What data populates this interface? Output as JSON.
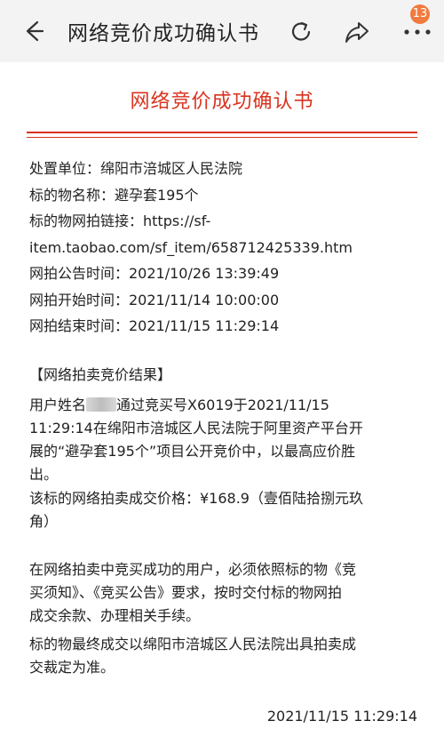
{
  "header": {
    "title": "网络竞价成功确认书",
    "badge_count": "13",
    "icons": [
      "back-arrow-icon",
      "refresh-icon",
      "share-icon",
      "more-icon"
    ]
  },
  "document": {
    "title": "网络竞价成功确认书",
    "accent_color": "#d8331f",
    "info": {
      "unit": "处置单位：绵阳市涪城区人民法院",
      "item_name": "标的物名称：避孕套195个",
      "link_line1": "标的物网拍链接：https://sf-",
      "link_line2": "item.taobao.com/sf_item/658712425339.htm",
      "announce_time": "网拍公告时间：2021/10/26 13:39:49",
      "start_time": "网拍开始时间：2021/11/14 10:00:00",
      "end_time": "网拍结束时间：2021/11/15 11:29:14"
    },
    "result_heading": "【网络拍卖竞价结果】",
    "result": {
      "l1_pre": "用户姓名",
      "l1_post": "通过竞买号X6019于2021/11/15",
      "l2": "11:29:14在绵阳市涪城区人民法院于阿里资产平台开",
      "l3": "展的“避孕套195个”项目公开竞价中，以最高应价胜",
      "l4": "出。",
      "price_l1": "该标的网络拍卖成交价格：¥168.9（壹佰陆拾捌元玖",
      "price_l2": "角）"
    },
    "notice": {
      "p1_l1": "在网络拍卖中竞买成功的用户，必须依照标的物《竞",
      "p1_l2": "买须知》、《竞买公告》要求，按时交付标的物网拍",
      "p1_l3": "成交余款、办理相关手续。",
      "p2_l1": "标的物最终成交以绵阳市涪城区人民法院出具拍卖成",
      "p2_l2": "交裁定为准。"
    },
    "footer_date": "2021/11/15 11:29:14"
  }
}
